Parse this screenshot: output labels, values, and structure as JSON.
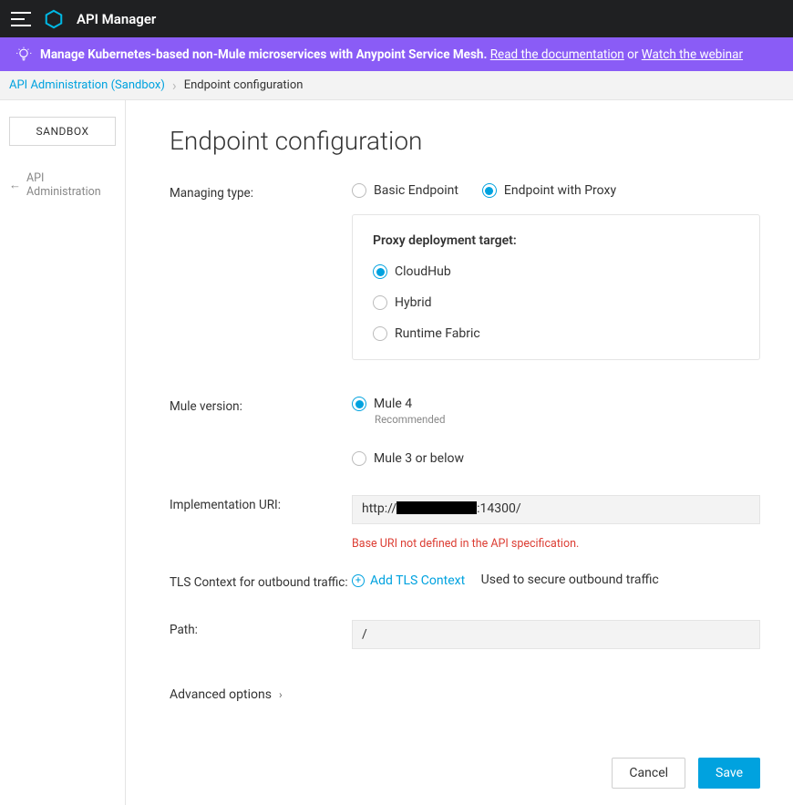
{
  "header": {
    "title": "API Manager"
  },
  "banner": {
    "bold": "Manage Kubernetes-based non-Mule microservices with Anypoint Service Mesh.",
    "link1": "Read the documentation",
    "or": " or ",
    "link2": "Watch the webinar"
  },
  "crumbs": {
    "link": "API Administration (Sandbox)",
    "current": "Endpoint configuration"
  },
  "sidebar": {
    "env": "SANDBOX",
    "back": "API Administration"
  },
  "page": {
    "title": "Endpoint configuration",
    "labels": {
      "managing_type": "Managing type:",
      "proxy_target": "Proxy deployment target:",
      "mule_version": "Mule version:",
      "impl_uri": "Implementation URI:",
      "tls": "TLS Context for outbound traffic:",
      "path": "Path:",
      "advanced": "Advanced options"
    },
    "options": {
      "managing_type": [
        "Basic Endpoint",
        "Endpoint with Proxy"
      ],
      "proxy_target": [
        "CloudHub",
        "Hybrid",
        "Runtime Fabric"
      ],
      "mule_version": [
        "Mule 4",
        "Mule 3 or below"
      ],
      "mule4_sub": "Recommended"
    },
    "values": {
      "impl_uri_prefix": "http://",
      "impl_uri_suffix": ":14300/",
      "impl_uri_error": "Base URI not defined in the API specification.",
      "add_tls": "Add TLS Context",
      "tls_hint": "Used to secure outbound traffic",
      "path": "/"
    },
    "buttons": {
      "cancel": "Cancel",
      "save": "Save"
    }
  }
}
